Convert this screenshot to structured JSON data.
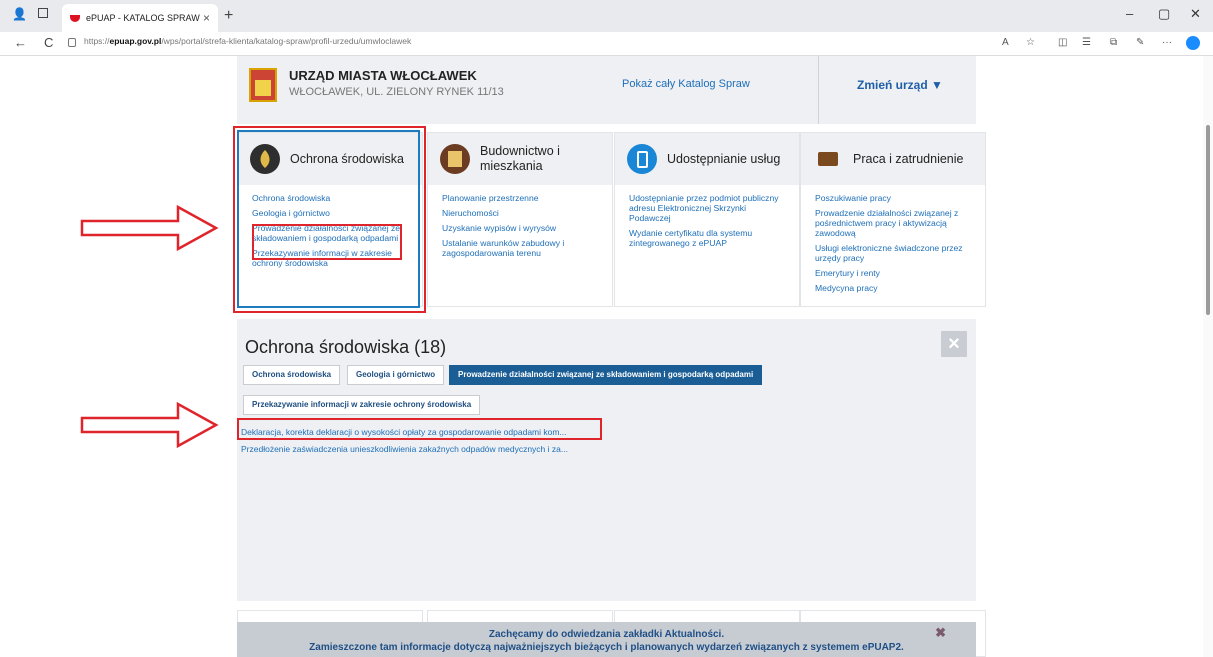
{
  "browser": {
    "tab_title": "ePUAP - KATALOG SPRAW",
    "tab_close": "×",
    "new_tab": "+",
    "url_prefix": "https://",
    "url_host": "epuap.gov.pl",
    "url_path": "/wps/portal/strefa-klienta/katalog-spraw/profil-urzedu/umwloclawek",
    "back": "←",
    "reload": "C",
    "minimize": "–",
    "maximize": "▢",
    "close": "✕"
  },
  "header": {
    "office_name": "URZĄD MIASTA WŁOCŁAWEK",
    "office_address": "WŁOCŁAWEK, UL. ZIELONY RYNEK 11/13",
    "show_catalog": "Pokaż cały Katalog Spraw",
    "change_office": "Zmień urząd ▼"
  },
  "cards": [
    {
      "title": "Ochrona środowiska",
      "icon": "leaf-icon",
      "links": [
        "Ochrona środowiska",
        "Geologia i górnictwo",
        "Prowadzenie działalności związanej ze składowaniem i gospodarką odpadami",
        "Przekazywanie informacji w zakresie ochrony środowiska"
      ]
    },
    {
      "title": "Budownictwo i mieszkania",
      "icon": "building-icon",
      "links": [
        "Planowanie przestrzenne",
        "Nieruchomości",
        "Uzyskanie wypisów i wyrysów",
        "Ustalanie warunków zabudowy i zagospodarowania terenu"
      ]
    },
    {
      "title": "Udostępnianie usług",
      "icon": "mobile-icon",
      "links": [
        "Udostępnianie przez podmiot publiczny adresu Elektronicznej Skrzynki Podawczej",
        "Wydanie certyfikatu dla systemu zintegrowanego z ePUAP"
      ]
    },
    {
      "title": "Praca i zatrudnienie",
      "icon": "briefcase-icon",
      "links": [
        "Poszukiwanie pracy",
        "Prowadzenie działalności związanej z pośrednictwem pracy i aktywizacją zawodową",
        "Usługi elektroniczne świadczone przez urzędy pracy",
        "Emerytury i renty",
        "Medycyna pracy"
      ]
    }
  ],
  "panel": {
    "title": "Ochrona środowiska (18)",
    "close": "×",
    "filters": [
      "Ochrona środowiska",
      "Geologia i górnictwo",
      "Prowadzenie działalności związanej ze składowaniem i gospodarką odpadami",
      "Przekazywanie informacji w zakresie ochrony środowiska"
    ],
    "active_filter_index": 2,
    "results": [
      "Deklaracja, korekta deklaracji o wysokości opłaty za gospodarowanie odpadami kom...",
      "Przedłożenie zaświadczenia unieszkodliwienia zakaźnych odpadów medycznych i za..."
    ]
  },
  "notice": {
    "line1": "Zachęcamy do odwiedzania zakładki Aktualności.",
    "line2": "Zamieszczone tam informacje dotyczą najważniejszych bieżących i planowanych wydarzeń związanych z systemem ePUAP2.",
    "close": "✖"
  },
  "colors": {
    "annotation_red": "#e0242b",
    "annotation_blue": "#1f7bbf",
    "active_filter": "#1b5e96",
    "link": "#1e6fb8"
  }
}
